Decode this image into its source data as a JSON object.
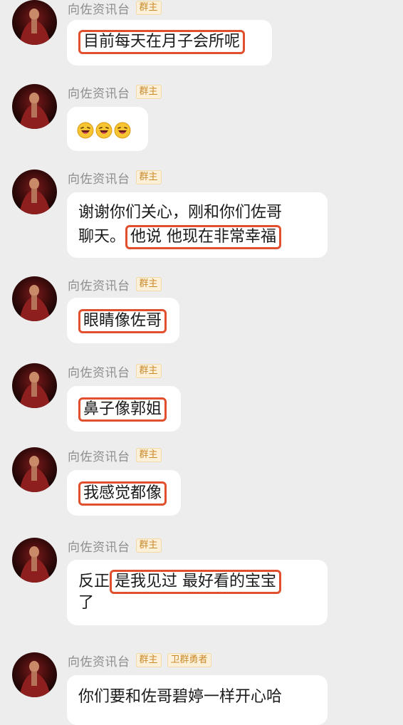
{
  "sender_name": "向佐资讯台",
  "badge_owner": "群主",
  "badge_guard": "卫群勇者",
  "messages": [
    {
      "text": "目前每天在月子会所呢"
    },
    {
      "emoji": "laughing-emoji",
      "count": 3
    },
    {
      "line1": "谢谢你们关心，刚和你们佐哥",
      "line2_a": "聊天。",
      "line2_b": "他说 他现在非常幸福"
    },
    {
      "text": "眼睛像佐哥"
    },
    {
      "text": "鼻子像郭姐"
    },
    {
      "text": "我感觉都像"
    },
    {
      "line1_a": "反正",
      "line1_b": "是我见过 最好看的宝宝",
      "line2": "了"
    },
    {
      "text": "你们要和佐哥碧婷一样开心哈"
    }
  ],
  "colors": {
    "background": "#ededed",
    "bubble": "#ffffff",
    "highlight": "#e0502f",
    "badge_bg": "#fdf0d9",
    "badge_text": "#c98a2c"
  }
}
